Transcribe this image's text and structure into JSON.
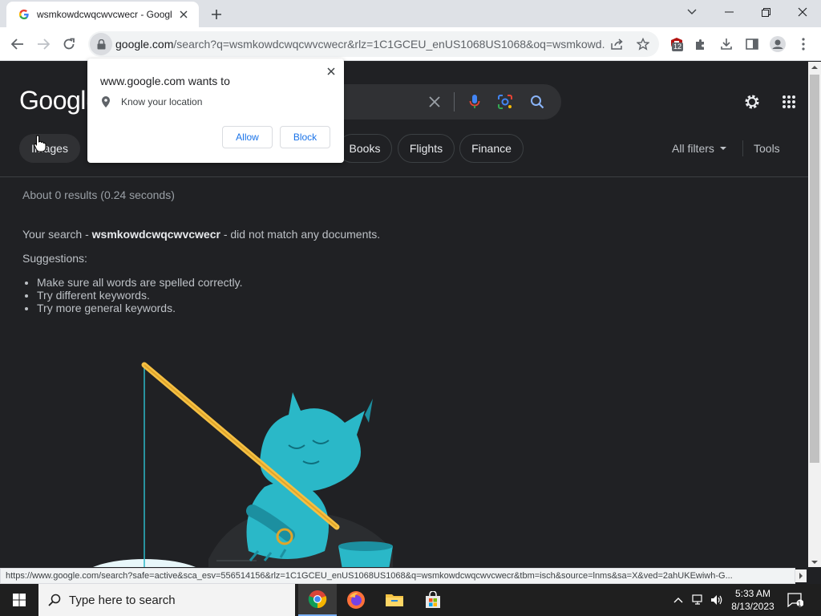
{
  "browser": {
    "tab_title": "wsmkowdcwqcwvcwecr - Google Search",
    "url_host": "google.com",
    "url_rest": "/search?q=wsmkowdcwqcwvcwecr&rlz=1C1GCEU_enUS1068US1068&oq=wsmkowd...",
    "extension_badge": "12"
  },
  "google": {
    "logo": "Google",
    "chips": [
      "Images",
      "Books",
      "Flights",
      "Finance"
    ],
    "all_filters": "All filters",
    "tools": "Tools",
    "stats": "About 0 results (0.24 seconds)",
    "nomatch_prefix": "Your search - ",
    "query": "wsmkowdcwqcwvcwecr",
    "nomatch_suffix": " - did not match any documents.",
    "suggestions_heading": "Suggestions:",
    "suggestions": [
      "Make sure all words are spelled correctly.",
      "Try different keywords.",
      "Try more general keywords."
    ]
  },
  "permission": {
    "title": "www.google.com wants to",
    "request": "Know your location",
    "allow": "Allow",
    "block": "Block"
  },
  "status_url": "https://www.google.com/search?safe=active&sca_esv=556514156&rlz=1C1GCEU_enUS1068US1068&q=wsmkowdcwqcwvcwecr&tbm=isch&source=lnms&sa=X&ved=2ahUKEwiwh-G...",
  "taskbar": {
    "search_placeholder": "Type here to search",
    "time": "5:33 AM",
    "date": "8/13/2023",
    "notification_count": "1"
  },
  "colors": {
    "page_bg": "#202124",
    "accent_blue": "#1a73e8",
    "yeti": "#2ab8c8"
  }
}
